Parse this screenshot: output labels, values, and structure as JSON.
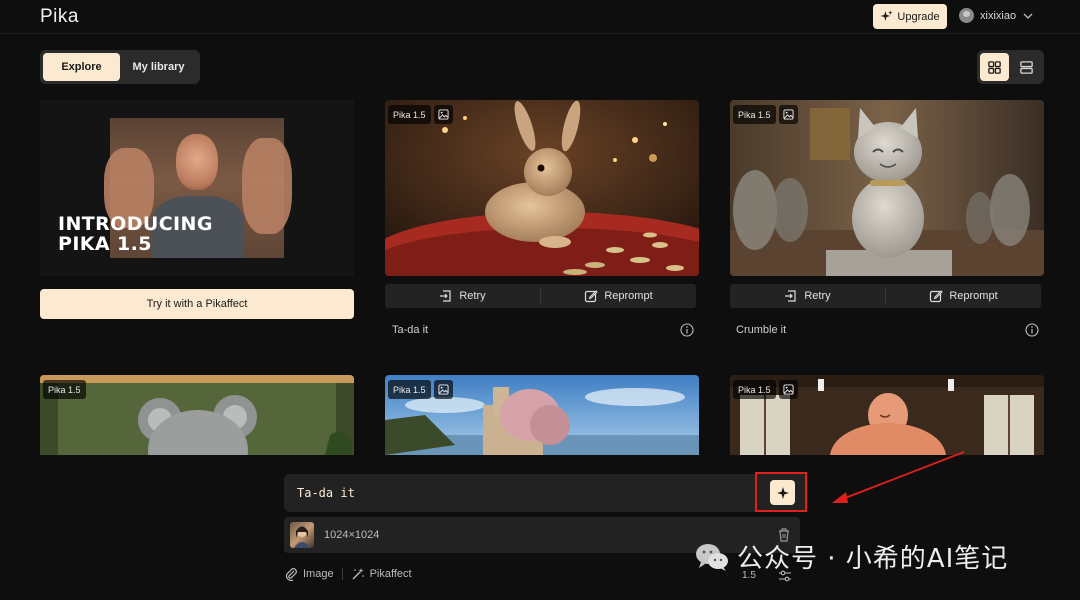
{
  "app": {
    "logo": "Pika"
  },
  "header": {
    "upgrade_label": "Upgrade",
    "username": "xixixiao"
  },
  "tabs": [
    {
      "label": "Explore",
      "active": true
    },
    {
      "label": "My library",
      "active": false
    }
  ],
  "view_toggle": {
    "active": "grid"
  },
  "promo": {
    "line1": "INTRODUCING",
    "line2": "PIKA 1.5",
    "cta_label": "Try it with a Pikaffect"
  },
  "cards": [
    {
      "badge": "Pika 1.5",
      "retry_label": "Retry",
      "reprompt_label": "Reprompt",
      "caption": "Ta-da it",
      "image": "rabbit-on-red-table"
    },
    {
      "badge": "Pika 1.5",
      "retry_label": "Retry",
      "reprompt_label": "Reprompt",
      "caption": "Crumble it",
      "image": "stone-cat-statue"
    },
    {
      "badge": "Pika 1.5",
      "image": "koala-plush"
    },
    {
      "badge": "Pika 1.5",
      "image": "coastal-castle"
    },
    {
      "badge": "Pika 1.5",
      "image": "sumo-figure-in-dojo"
    }
  ],
  "prompt": {
    "value": "Ta-da it"
  },
  "attachment": {
    "dimensions": "1024×1024"
  },
  "tools": {
    "image_label": "Image",
    "pikaffect_label": "Pikaffect",
    "model_version": "1.5"
  },
  "watermark": {
    "text": "公众号 · 小希的AI笔记"
  },
  "colors": {
    "accent": "#fbead0",
    "background": "#0e0e0e",
    "highlight": "#e0201c"
  }
}
